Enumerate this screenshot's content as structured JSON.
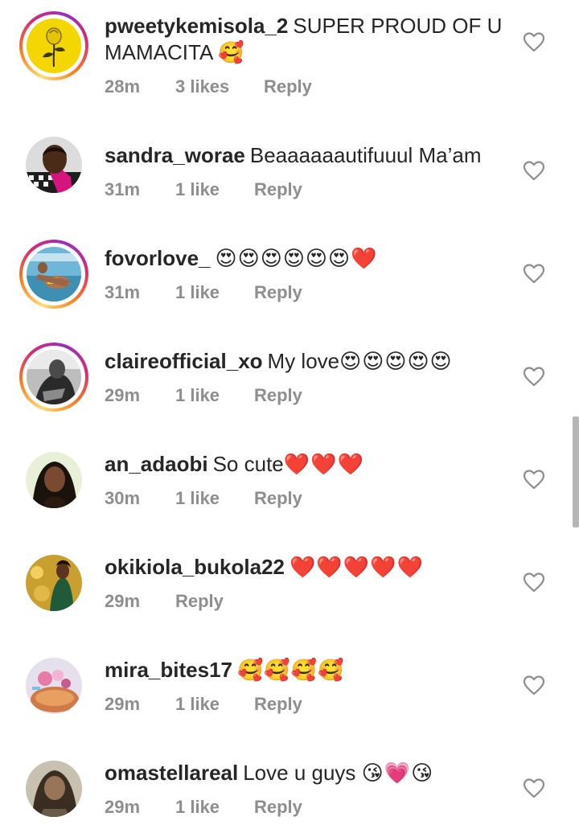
{
  "comments": [
    {
      "username": "pweetykemisola_2",
      "text": "SUPER PROUD OF U MAMACITA",
      "emoji": "🥰",
      "time": "28m",
      "likes": "3 likes",
      "reply": "Reply"
    },
    {
      "username": "sandra_worae",
      "text": "Beaaaaaautifuuul Ma’am",
      "emoji": "",
      "time": "31m",
      "likes": "1 like",
      "reply": "Reply"
    },
    {
      "username": "fovorlove_",
      "text": "",
      "emoji": "😍😍😍😍😍😍❤️",
      "time": "31m",
      "likes": "1 like",
      "reply": "Reply"
    },
    {
      "username": "claireofficial_xo",
      "text": "My love",
      "emoji": "😍😍😍😍😍",
      "time": "29m",
      "likes": "1 like",
      "reply": "Reply"
    },
    {
      "username": "an_adaobi",
      "text": "So cute",
      "emoji": "❤️❤️❤️",
      "time": "30m",
      "likes": "1 like",
      "reply": "Reply"
    },
    {
      "username": "okikiola_bukola22",
      "text": "",
      "emoji": "❤️❤️❤️❤️❤️",
      "time": "29m",
      "likes": "",
      "reply": "Reply"
    },
    {
      "username": "mira_bites17",
      "text": "",
      "emoji": "🥰🥰🥰🥰",
      "time": "29m",
      "likes": "1 like",
      "reply": "Reply"
    },
    {
      "username": "omastellareal",
      "text": "Love u guys",
      "emoji": "😘💗😘",
      "time": "29m",
      "likes": "1 like",
      "reply": "Reply"
    }
  ],
  "icons": {
    "like": "heart-outline-icon"
  },
  "colors": {
    "text_primary": "#262626",
    "text_secondary": "#8e8e8e",
    "story_ring": [
      "#feda75",
      "#fa7e1e",
      "#d62976",
      "#962fbf"
    ]
  }
}
